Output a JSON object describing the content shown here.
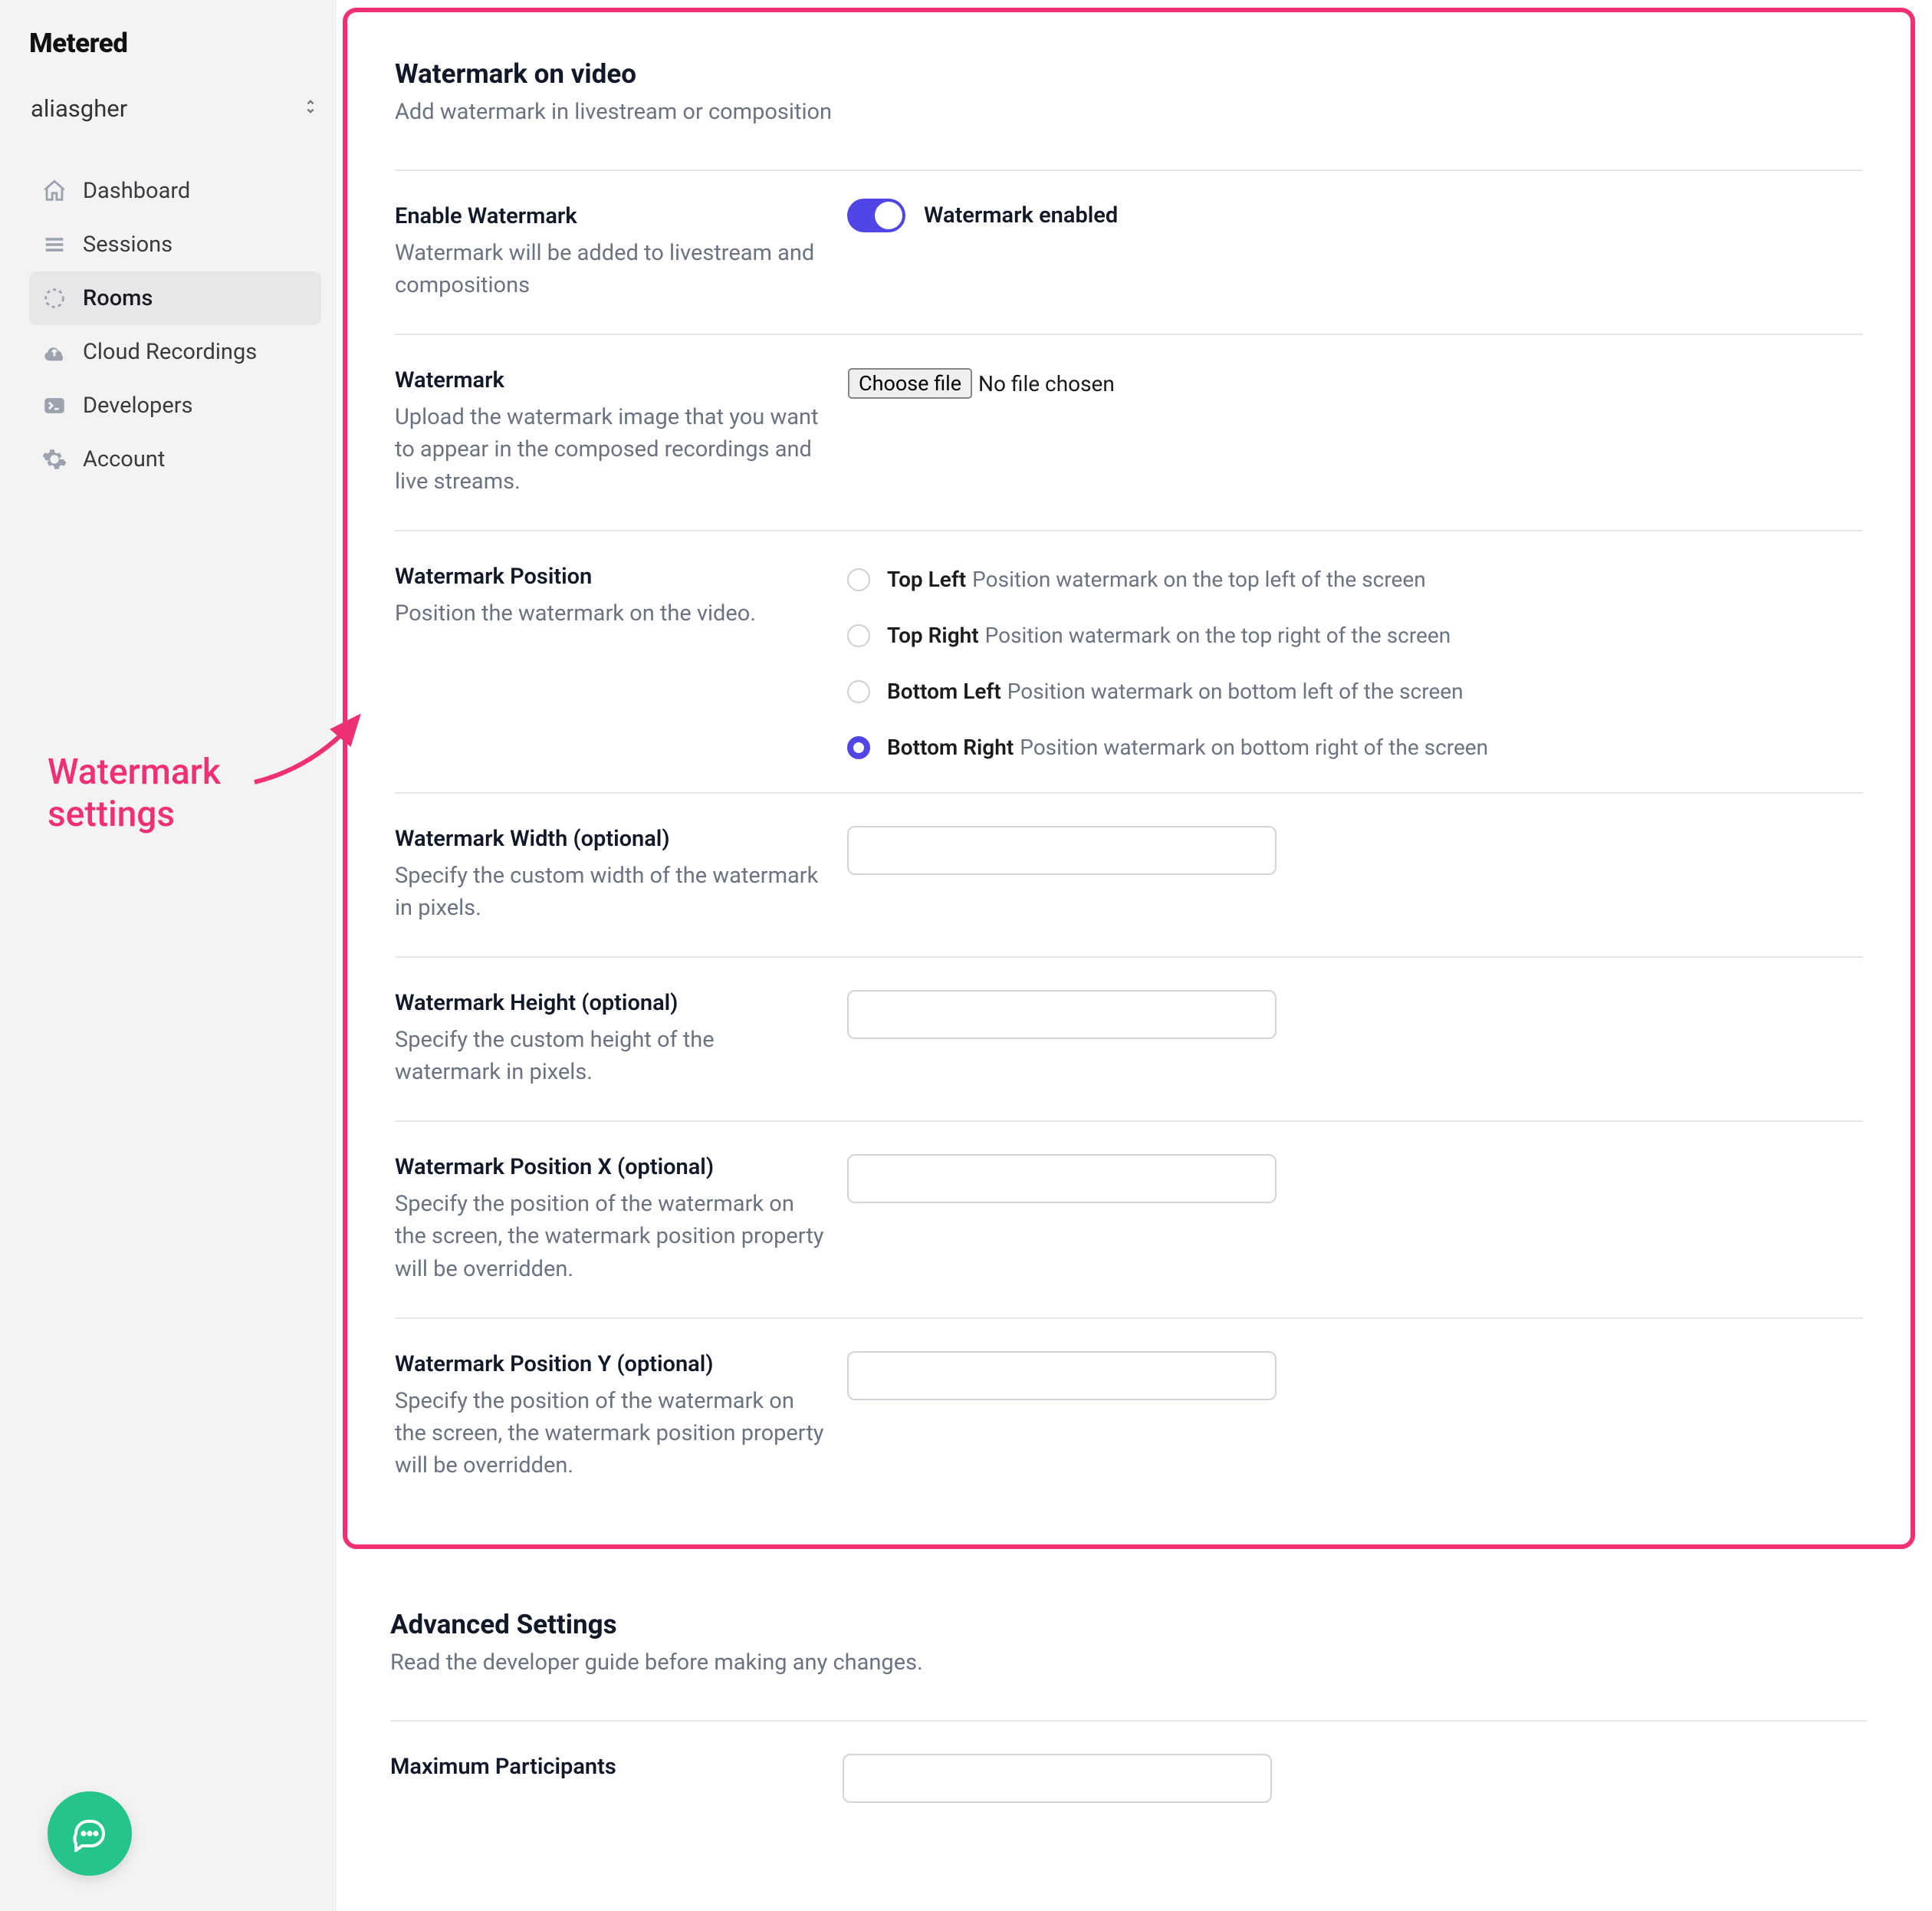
{
  "brand": "Metered",
  "user": "aliasgher",
  "sidebar": {
    "items": [
      {
        "label": "Dashboard"
      },
      {
        "label": "Sessions"
      },
      {
        "label": "Rooms"
      },
      {
        "label": "Cloud Recordings"
      },
      {
        "label": "Developers"
      },
      {
        "label": "Account"
      }
    ]
  },
  "callout": {
    "line1": "Watermark",
    "line2": "settings"
  },
  "section": {
    "title": "Watermark on video",
    "subtitle": "Add watermark in livestream or composition"
  },
  "enable": {
    "label": "Enable Watermark",
    "desc": "Watermark will be added to livestream and compositions",
    "status": "Watermark enabled"
  },
  "upload": {
    "label": "Watermark",
    "desc": "Upload the watermark image that you want to appear in the composed recordings and live streams.",
    "choose": "Choose file",
    "nofile": "No file chosen"
  },
  "position": {
    "label": "Watermark Position",
    "desc": "Position the watermark on the video.",
    "options": [
      {
        "name": "Top Left",
        "desc": "Position watermark on the top left of the screen"
      },
      {
        "name": "Top Right",
        "desc": "Position watermark on the top right of the screen"
      },
      {
        "name": "Bottom Left",
        "desc": "Position watermark on bottom left of the screen"
      },
      {
        "name": "Bottom Right",
        "desc": "Position watermark on bottom right of the screen"
      }
    ]
  },
  "width": {
    "label": "Watermark Width (optional)",
    "desc": "Specify the custom width of the watermark in pixels."
  },
  "height": {
    "label": "Watermark Height (optional)",
    "desc": "Specify the custom height of the watermark in pixels."
  },
  "posx": {
    "label": "Watermark Position X (optional)",
    "desc": "Specify the position of the watermark on the screen, the watermark position property will be overridden."
  },
  "posy": {
    "label": "Watermark Position Y (optional)",
    "desc": "Specify the position of the watermark on the screen, the watermark position property will be overridden."
  },
  "advanced": {
    "title": "Advanced Settings",
    "subtitle": "Read the developer guide before making any changes.",
    "maxpart": "Maximum Participants"
  }
}
